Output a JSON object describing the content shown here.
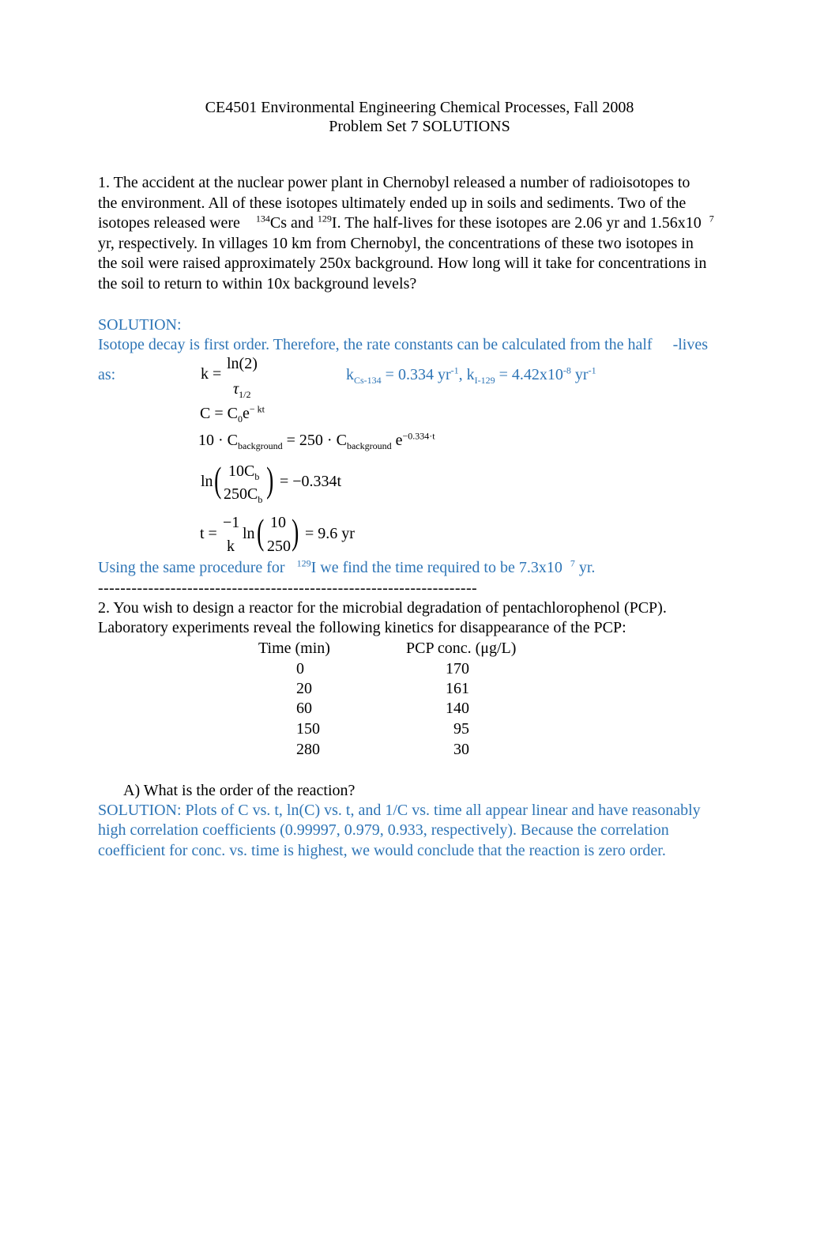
{
  "header": {
    "title": "CE4501 Environmental Engineering Chemical Processes, Fall 2008",
    "subtitle": "Problem Set 7 SOLUTIONS"
  },
  "problem1": {
    "line1": "1. The accident at the nuclear power plant in Chernobyl released a number of radioisotopes to",
    "line2": "the environment. All of these isotopes ultimately ended up in soils and sediments. Two of the",
    "line3_a": "isotopes released were",
    "iso1_mass": "134",
    "iso1_sym": "Cs and",
    "iso2_mass": "129",
    "iso2_sym": "I. The",
    "line3_b": "half-lives for these isotopes are 2.06 yr and 1.56x10",
    "line3_exp": "7",
    "line4": "yr, respectively. In villages 10 km from Chernobyl, the concentrations of these two isotopes in",
    "line5": "the soil were raised approximately 250x background. How long will it take for concentrations in",
    "line6": "the soil to return to within 10x background levels?"
  },
  "solution1": {
    "label": "SOLUTION:",
    "intro_a": "Isotope decay is first order. Therefore, the rate constants can be calculated from the half",
    "intro_b": "-lives",
    "as": "as:",
    "eq_k": {
      "lhs": "k =",
      "num": "ln(2)",
      "den": "τ",
      "den_sub": "1/2"
    },
    "rates": {
      "k1": "k",
      "k1_sub": "Cs-134",
      "k1_val": " = 0.334 yr",
      "k1_exp": "-1",
      "sep": ", k",
      "k2_sub": "I-129",
      "k2_val": " = 4.42x10",
      "k2_exp1": "-8",
      "k2_unit": " yr",
      "k2_exp2": "-1"
    },
    "eq_c": {
      "a": "C = C",
      "a_sub": "0",
      "b": "e",
      "b_sup": "− kt"
    },
    "eq_bg": {
      "a": "10 · C",
      "a_sub": "background",
      "b": " = 250 · C",
      "b_sub": "background",
      "c": " e",
      "c_sup": "−0.334·t"
    },
    "eq_ln": {
      "ln": "ln",
      "num": "10C",
      "num_sub": "b",
      "den": "250C",
      "den_sub": "b",
      "rhs": "= −0.334t"
    },
    "eq_t": {
      "lhs": "t =",
      "num": "−1",
      "den": "k",
      "ln": "ln",
      "inner_num": "10",
      "inner_den": "250",
      "rhs": "= 9.6 yr"
    },
    "conclusion_a": "Using the same procedure for",
    "conclusion_mass": "129",
    "conclusion_b": "I we find the time required to be 7.3x10",
    "conclusion_exp": "7",
    "conclusion_c": " yr."
  },
  "divider": "--------------------------------------------------------------------",
  "problem2": {
    "line1": "2. You wish to design a reactor for the microbial degradation of pentachlorophenol (PCP).",
    "line2": "Laboratory experiments reveal the following kinetics for disappearance of the PCP:",
    "table": {
      "headers": [
        "Time (min)",
        "PCP conc. (μg/L)"
      ],
      "rows": [
        [
          "0",
          "170"
        ],
        [
          "20",
          "161"
        ],
        [
          "60",
          "140"
        ],
        [
          "150",
          "95"
        ],
        [
          "280",
          "30"
        ]
      ]
    },
    "question_a": "A)  What is the order of the reaction?",
    "solution_a": [
      "SOLUTION: Plots of C vs. t, ln(C) vs. t, and 1/C vs. time all appear linear and have reasonably",
      "high correlation coefficients (0.99997, 0.979, 0.933, respectively). Because the correlation",
      "coefficient for conc. vs. time is highest, we would conclude that the reaction is zero order."
    ]
  }
}
